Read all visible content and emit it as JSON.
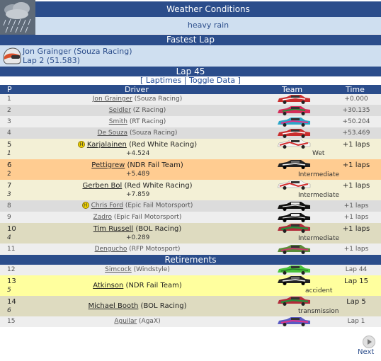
{
  "weather": {
    "title": "Weather Conditions",
    "description": "heavy rain",
    "icon": "rain-cloud-icon"
  },
  "fastest_lap": {
    "title": "Fastest Lap",
    "driver": "Jon Grainger (Souza Racing)",
    "lap": "Lap 2 (51.583)"
  },
  "lap": {
    "title": "Lap 45",
    "bracket_open": "[",
    "laptimes_label": "Laptimes",
    "separator": "|",
    "toggle_label": "Toggle Data",
    "bracket_close": "]"
  },
  "columns": {
    "p": "P",
    "driver": "Driver",
    "team": "Team",
    "time": "Time"
  },
  "rows": [
    {
      "pos": "1",
      "name": "Jon Grainger",
      "team": "(Souza Racing)",
      "time": "+0.000"
    },
    {
      "pos": "2",
      "name": "Seidler",
      "team": "(Z Racing)",
      "time": "+30.135"
    },
    {
      "pos": "3",
      "name": "Smith",
      "team": "(RT Racing)",
      "time": "+50.204"
    },
    {
      "pos": "4",
      "name": "De Souza",
      "team": "(Souza Racing)",
      "time": "+53.469"
    },
    {
      "pos": "5",
      "name": "Karjalainen",
      "team": "(Red White Racing)",
      "time": "+1 laps",
      "sub_pos": "1",
      "gap": "+4.524",
      "tyre": "Wet"
    },
    {
      "pos": "6",
      "name": "Pettigrew",
      "team": "(NDR Fail Team)",
      "time": "+1 laps",
      "sub_pos": "2",
      "gap": "+5.489",
      "tyre": "Intermediate"
    },
    {
      "pos": "7",
      "name": "Gerben Bol",
      "team": "(Red White Racing)",
      "time": "+1 laps",
      "sub_pos": "3",
      "gap": "+7.859",
      "tyre": "Intermediate"
    },
    {
      "pos": "8",
      "name": "Chris Ford",
      "team": "(Epic Fail Motorsport)",
      "time": "+1 laps"
    },
    {
      "pos": "9",
      "name": "Zadro",
      "team": "(Epic Fail Motorsport)",
      "time": "+1 laps"
    },
    {
      "pos": "10",
      "name": "Tim Russell",
      "team": "(BOL Racing)",
      "time": "+1 laps",
      "sub_pos": "4",
      "gap": "+0.289",
      "tyre": "Intermediate"
    },
    {
      "pos": "11",
      "name": "Dengucho",
      "team": "(RFP Motosport)",
      "time": "+1 laps"
    }
  ],
  "retirements": {
    "title": "Retirements",
    "rows": [
      {
        "pos": "12",
        "name": "Simcock",
        "team": "(Windstyle)",
        "time": "Lap 44"
      },
      {
        "pos": "13",
        "name": "Atkinson",
        "team": "(NDR Fail Team)",
        "time": "Lap 15",
        "sub_pos": "5",
        "reason": "accident"
      },
      {
        "pos": "14",
        "name": "Michael Booth",
        "team": "(BOL Racing)",
        "time": "Lap 5",
        "sub_pos": "6",
        "reason": "transmission"
      },
      {
        "pos": "15",
        "name": "Aguilar",
        "team": "(AgaX)",
        "time": "Lap 1"
      }
    ]
  },
  "coin_letter": "H",
  "next_label": "Next",
  "colors": {
    "header": "#2b4d8b",
    "light_blue": "#cfdff0",
    "row_light": "#eeeeee",
    "row_dark": "#dcdcdc",
    "cream": "#f3f0d6",
    "beige": "#dedbc0",
    "orange": "#ffcc91",
    "yellow": "#ffff9e"
  }
}
